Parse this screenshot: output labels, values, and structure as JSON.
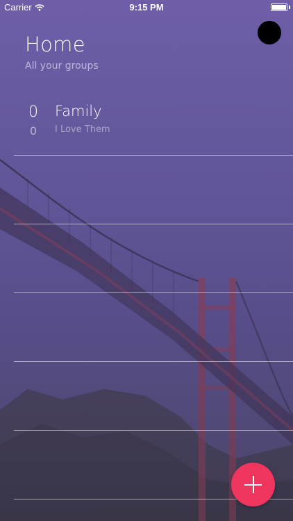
{
  "status_bar": {
    "carrier": "Carrier",
    "time": "9:15 PM",
    "battery_level": 1.0
  },
  "header": {
    "title": "Home",
    "subtitle": "All your groups"
  },
  "groups": [
    {
      "count_primary": "0",
      "count_secondary": "0",
      "name": "Family",
      "description": "I Love Them"
    },
    {},
    {},
    {},
    {},
    {}
  ],
  "colors": {
    "background_tint": "#675aa0",
    "fab": "#f0365f",
    "avatar": "#000000"
  },
  "icons": {
    "wifi": "wifi-icon",
    "add": "plus-icon"
  }
}
